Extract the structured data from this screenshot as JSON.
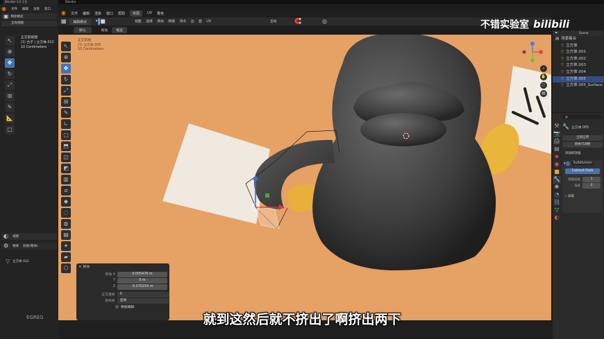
{
  "top_menu": {
    "items": [
      "文件",
      "编辑",
      "渲染",
      "窗口",
      "帮助"
    ],
    "active_tab": "布局",
    "other_tabs": [
      "UV",
      "着色"
    ]
  },
  "blender_bar": {
    "title": "Blender"
  },
  "browser_tab": {
    "title": "Blender 3.0 工艺"
  },
  "header": {
    "mode": "编辑模式",
    "orientation": "默认",
    "snap": "拖动",
    "select": "框选",
    "view_menu": [
      "视图",
      "选择",
      "添加",
      "网格",
      "顶点",
      "边",
      "面",
      "UV"
    ],
    "pivot": "全局"
  },
  "left_panel": {
    "header": "物体模式",
    "sub_header": "全局视图",
    "info_lines": [
      "正交前视图",
      "(1) 台子 | 立方体.012",
      "10 Centimeters"
    ],
    "bottom_header_1": "视图",
    "bottom_header_2": "物体",
    "bottom_header_3": "材质(物体)",
    "obj_name": "立方体.012",
    "channel_label": "EGREG"
  },
  "viewport_overlay": {
    "line1": "正交前视",
    "line2": "(1) 立方体.005",
    "line3": "10 Centimeters"
  },
  "op_panel": {
    "title": "移动",
    "rows": [
      {
        "label": "移动 X",
        "value": "0.005476 m"
      },
      {
        "label": "Y",
        "value": "0 m"
      },
      {
        "label": "Z",
        "value": "-0.070254 m"
      }
    ],
    "axis_label": "正交坐标",
    "axis_value": "X",
    "orient_label": "坐标系",
    "orient_value": "全局",
    "checkbox_label": "数据编辑"
  },
  "watermark": {
    "text": "不错实验室",
    "logo": "bilibili"
  },
  "outliner": {
    "scene": "Scene",
    "rows": [
      "场景集合",
      "立方体",
      "立方体.001",
      "立方体.002",
      "立方体.003",
      "立方体.004",
      "立方体.005",
      "立方体.005_Surface"
    ],
    "selected_index": 6
  },
  "properties": {
    "object_name": "立方体.005",
    "buttons": [
      "全部应用",
      "网格可调整"
    ],
    "section": "添加修改器",
    "modifier": "Subdivision",
    "method": "Catmull-Clark",
    "row1_label": "视图层级",
    "row1_value": "1",
    "row2_label": "渲染",
    "row2_value": "2",
    "advanced": "高级"
  },
  "subtitle": {
    "text": "就到这然后就不挤出了啊挤出两下"
  },
  "colors": {
    "background": "#e6a164",
    "accent": "#4772b3",
    "panel": "#2b2b2b"
  }
}
